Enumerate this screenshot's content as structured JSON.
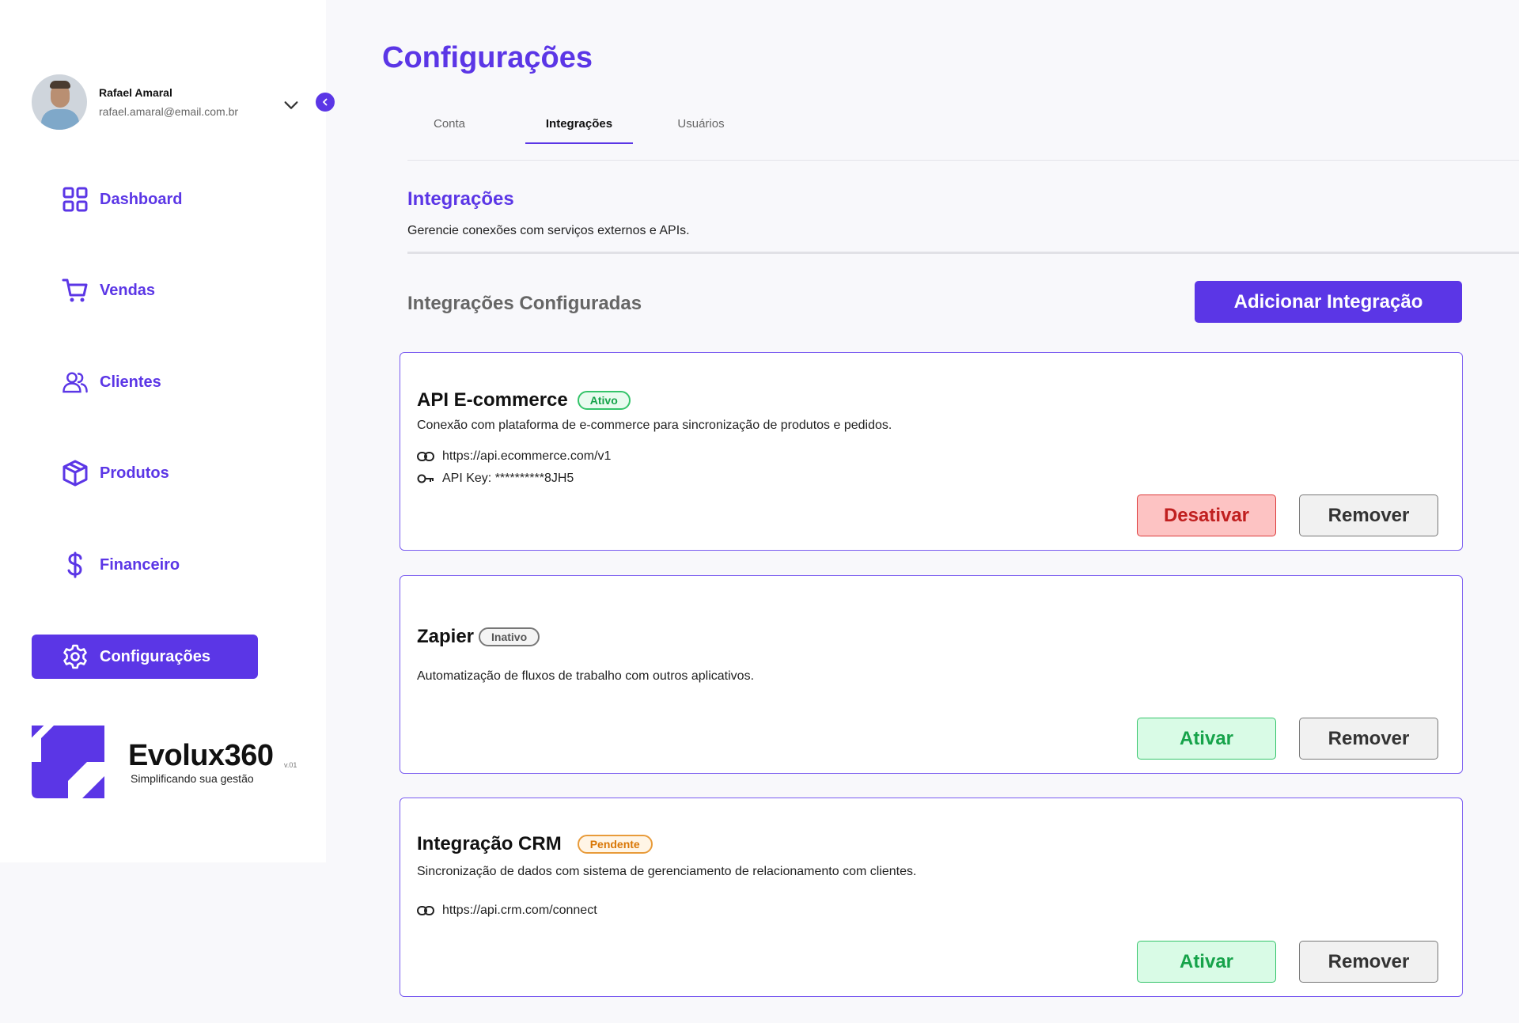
{
  "sidebar": {
    "user": {
      "name": "Rafael Amaral",
      "email": "rafael.amaral@email.com.br"
    },
    "nav": [
      {
        "label": "Dashboard",
        "icon": "grid-icon"
      },
      {
        "label": "Vendas",
        "icon": "cart-icon"
      },
      {
        "label": "Clientes",
        "icon": "users-icon"
      },
      {
        "label": "Produtos",
        "icon": "box-icon"
      },
      {
        "label": "Financeiro",
        "icon": "dollar-icon"
      },
      {
        "label": "Configurações",
        "icon": "gear-icon",
        "active": true
      }
    ],
    "brand": {
      "name": "Evolux360",
      "version": "v.01",
      "tagline": "Simplificando sua gestão"
    }
  },
  "page": {
    "title": "Configurações"
  },
  "tabs": [
    {
      "label": "Conta"
    },
    {
      "label": "Integrações",
      "active": true
    },
    {
      "label": "Usuários"
    }
  ],
  "section": {
    "title": "Integrações",
    "description": "Gerencie conexões com serviços externos e APIs.",
    "list_title": "Integrações Configuradas",
    "add_button": "Adicionar Integração"
  },
  "integrations": [
    {
      "name": "API E-commerce",
      "status": "Ativo",
      "description": "Conexão com plataforma de e-commerce para sincronização de produtos e pedidos.",
      "url": "https://api.ecommerce.com/v1",
      "api_key": "API Key: **********8JH5",
      "primary_action": "Desativar",
      "secondary_action": "Remover"
    },
    {
      "name": "Zapier",
      "status": "Inativo",
      "description": "Automatização de fluxos de trabalho com outros aplicativos.",
      "primary_action": "Ativar",
      "secondary_action": "Remover"
    },
    {
      "name": "Integração CRM",
      "status": "Pendente",
      "description": "Sincronização de dados com sistema de gerenciamento de relacionamento com clientes.",
      "url": "https://api.crm.com/connect",
      "primary_action": "Ativar",
      "secondary_action": "Remover"
    }
  ],
  "colors": {
    "accent": "#5b36e6",
    "success": "#16a34a",
    "danger": "#c01f1f",
    "pending": "#d97706"
  }
}
